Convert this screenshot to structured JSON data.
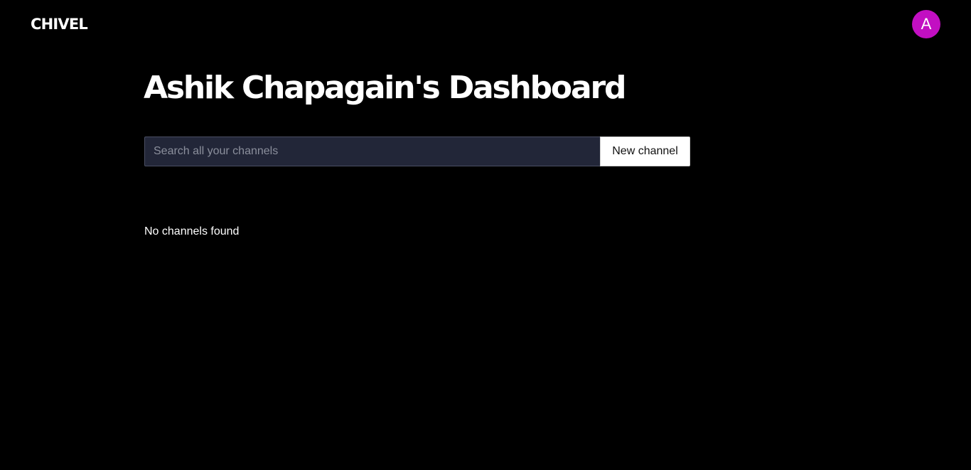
{
  "header": {
    "logo_text": "CHIVEL",
    "avatar_initial": "A",
    "avatar_color": "#c20fc2"
  },
  "main": {
    "title": "Ashik Chapagain's Dashboard",
    "search": {
      "placeholder": "Search all your channels",
      "value": ""
    },
    "new_channel_label": "New channel",
    "empty_message": "No channels found"
  },
  "theme": {
    "background": "#000000",
    "input_background": "#222638",
    "text": "#ffffff"
  }
}
